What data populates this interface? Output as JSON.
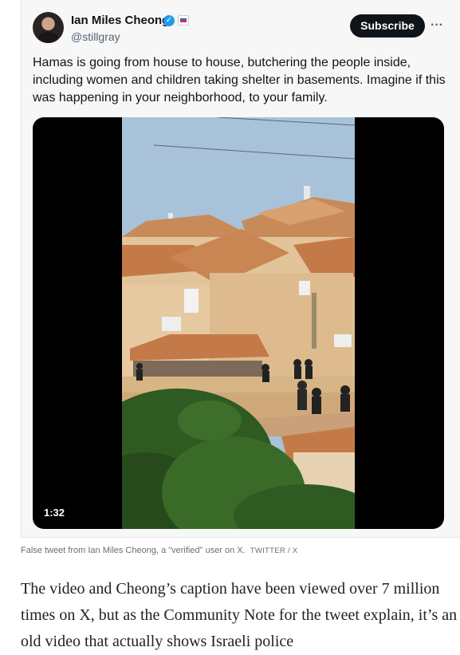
{
  "tweet": {
    "author_name": "Ian Miles Cheong",
    "author_handle": "@stillgray",
    "verified_glyph": "✓",
    "subscribe_label": "Subscribe",
    "more_glyph": "···",
    "text": "Hamas is going from house to house, butchering the people inside, including women and children taking shelter in basements. Imagine if this was happening in your neighborhood, to your family.",
    "video_duration": "1:32",
    "icons": [
      "avatar",
      "verified-icon",
      "affiliation-badge-icon",
      "more-icon"
    ]
  },
  "caption": {
    "text": "False tweet from Ian Miles Cheong, a \"verified\" user on X.",
    "credit": "TWITTER / X"
  },
  "article": {
    "paragraph": "The video and Cheong’s caption have been viewed over 7 million times on X, but as the Community Note for the tweet explain, it’s an old video that actually shows Israeli police"
  },
  "colors": {
    "accent_verified": "#1d9bf0",
    "button_bg": "#0f1419",
    "card_bg": "#f7f7f8"
  }
}
